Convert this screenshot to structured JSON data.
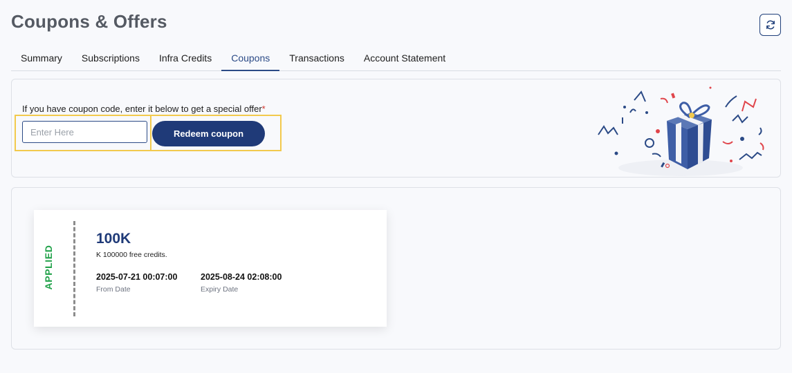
{
  "header": {
    "title": "Coupons & Offers",
    "refresh_icon": "refresh-icon"
  },
  "tabs": [
    {
      "label": "Summary",
      "active": false
    },
    {
      "label": "Subscriptions",
      "active": false
    },
    {
      "label": "Infra Credits",
      "active": false
    },
    {
      "label": "Coupons",
      "active": true
    },
    {
      "label": "Transactions",
      "active": false
    },
    {
      "label": "Account Statement",
      "active": false
    }
  ],
  "redeem": {
    "prompt": "If you have coupon code, enter it below to get a special offer",
    "required_mark": "*",
    "input_value": "",
    "input_placeholder": "Enter Here",
    "button_label": "Redeem coupon",
    "illustration_icon": "gift-box-confetti-icon"
  },
  "coupons": [
    {
      "status": "APPLIED",
      "title": "100K",
      "description": "K 100000 free credits.",
      "from_date": "2025-07-21 00:07:00",
      "from_label": "From Date",
      "expiry_date": "2025-08-24 02:08:00",
      "expiry_label": "Expiry Date"
    }
  ],
  "colors": {
    "primary": "#1f3a78",
    "active_tab": "#2b4a86",
    "applied": "#22a24a",
    "highlight": "#f2c94c",
    "required": "#d0342c"
  }
}
